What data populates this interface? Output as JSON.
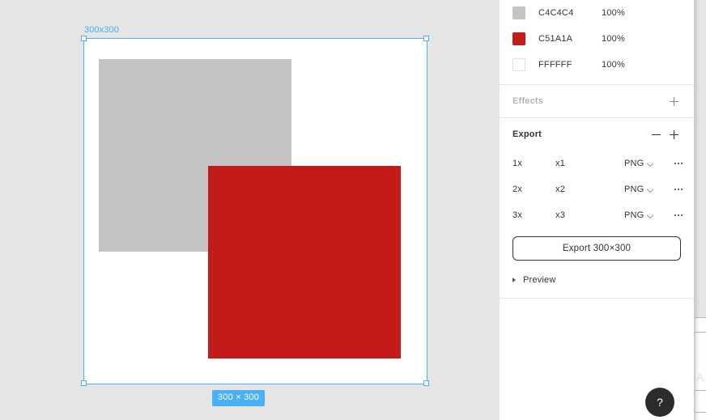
{
  "canvas": {
    "background_color": "#E5E5E5",
    "selection_color": "#4AB0F7",
    "frame": {
      "label": "300x300",
      "background_color": "#FFFFFF",
      "size_badge": "300 × 300"
    },
    "shapes": [
      {
        "name": "gray-rectangle",
        "color": "#C4C4C4"
      },
      {
        "name": "red-rectangle",
        "color": "#C51A1A"
      }
    ]
  },
  "panel": {
    "fills": {
      "rows": [
        {
          "swatch": "#C4C4C4",
          "hex": "C4C4C4",
          "opacity": "100%"
        },
        {
          "swatch": "#C51A1A",
          "hex": "C51A1A",
          "opacity": "100%"
        },
        {
          "swatch": "#FFFFFF",
          "hex": "FFFFFF",
          "opacity": "100%"
        }
      ]
    },
    "effects": {
      "title": "Effects",
      "add_icon": "plus-icon"
    },
    "export": {
      "title": "Export",
      "remove_icon": "minus-icon",
      "add_icon": "plus-icon",
      "rows": [
        {
          "scale": "1x",
          "suffix": "x1",
          "format": "PNG"
        },
        {
          "scale": "2x",
          "suffix": "x2",
          "format": "PNG"
        },
        {
          "scale": "3x",
          "suffix": "x3",
          "format": "PNG"
        }
      ],
      "export_button": "Export 300×300",
      "preview": "Preview"
    }
  },
  "help": {
    "label": "?"
  }
}
